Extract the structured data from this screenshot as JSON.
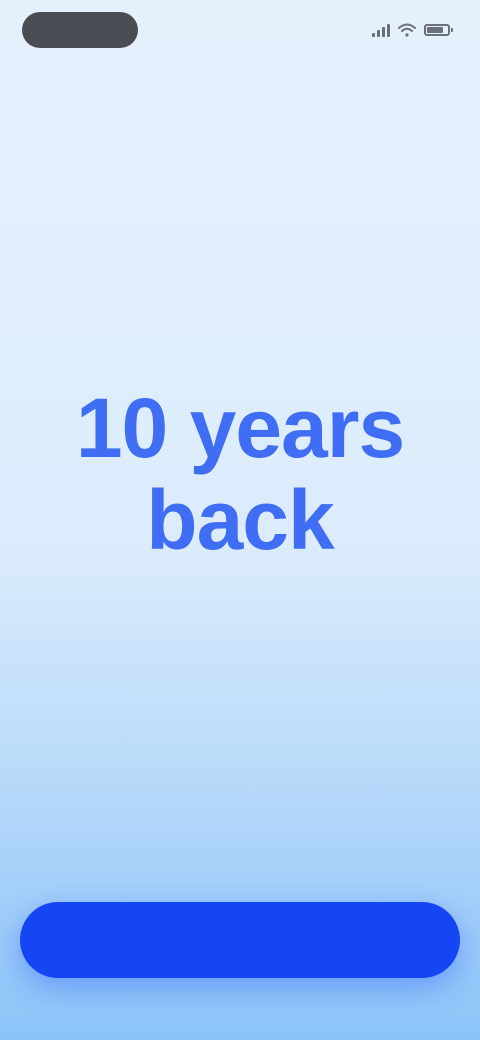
{
  "status_bar": {
    "time": "",
    "icons": [
      "signal-icon",
      "wifi-icon",
      "battery-icon"
    ]
  },
  "main": {
    "subtitle": "",
    "headline": "10 years back"
  },
  "cta": {
    "label": ""
  },
  "colors": {
    "accent": "#3f6df4",
    "button": "#1447f3",
    "background_top": "#e5f1fd",
    "background_bottom": "#8cc4f8"
  }
}
